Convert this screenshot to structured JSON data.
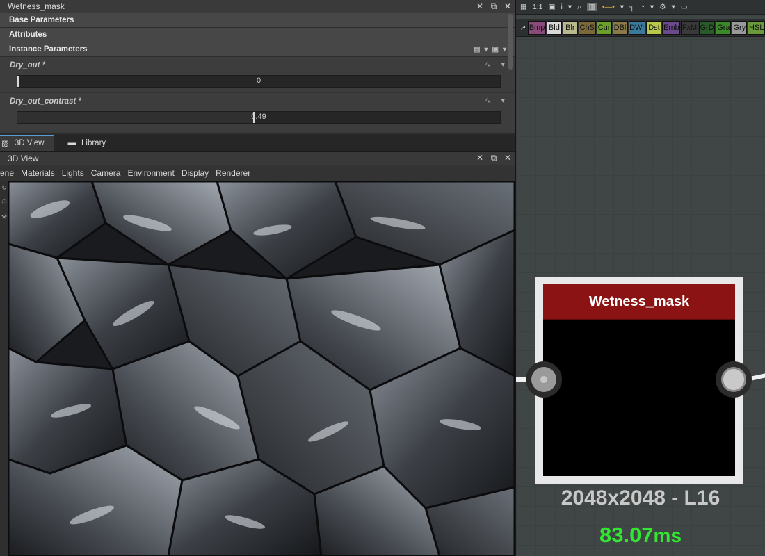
{
  "params_panel": {
    "title": "Wetness_mask",
    "sections": {
      "base": "Base Parameters",
      "attributes": "Attributes",
      "instance": "Instance Parameters"
    },
    "parameters": [
      {
        "name": "Dry_out *",
        "value": "0",
        "normalized": 0.0
      },
      {
        "name": "Dry_out_contrast *",
        "value": "0.49",
        "normalized": 0.49
      }
    ]
  },
  "view3d": {
    "tabs": [
      "3D View",
      "Library"
    ],
    "panel_title": "3D View",
    "menu": [
      "cene",
      "Materials",
      "Lights",
      "Camera",
      "Environment",
      "Display",
      "Renderer"
    ]
  },
  "graph": {
    "toolbar": {
      "zoom": "1:1",
      "info": "i"
    },
    "atoms": [
      {
        "label": "Bmp",
        "color": "#8a4a7a"
      },
      {
        "label": "Bld",
        "color": "#d8d8d8"
      },
      {
        "label": "Blr",
        "color": "#b9b990"
      },
      {
        "label": "ChS",
        "color": "#7a6a3a"
      },
      {
        "label": "Cur",
        "color": "#6aa02a"
      },
      {
        "label": "DBl",
        "color": "#8a7a4a"
      },
      {
        "label": "DWr",
        "color": "#3a7a9a"
      },
      {
        "label": "Dst",
        "color": "#b8c84a"
      },
      {
        "label": "Emb",
        "color": "#6a4a8a"
      },
      {
        "label": "FxM",
        "color": "#3a3a3a"
      },
      {
        "label": "GrD",
        "color": "#2a5a2a"
      },
      {
        "label": "Gra",
        "color": "#3a8a2a"
      },
      {
        "label": "Gry",
        "color": "#9a9a9a"
      },
      {
        "label": "HSL",
        "color": "#6a9a3a"
      }
    ],
    "node": {
      "title": "Wetness_mask",
      "resolution": "2048x2048 - L16",
      "timing_value": "83.07",
      "timing_unit": "ms",
      "header_color": "#8c1313",
      "timing_color": "#32e632"
    }
  }
}
